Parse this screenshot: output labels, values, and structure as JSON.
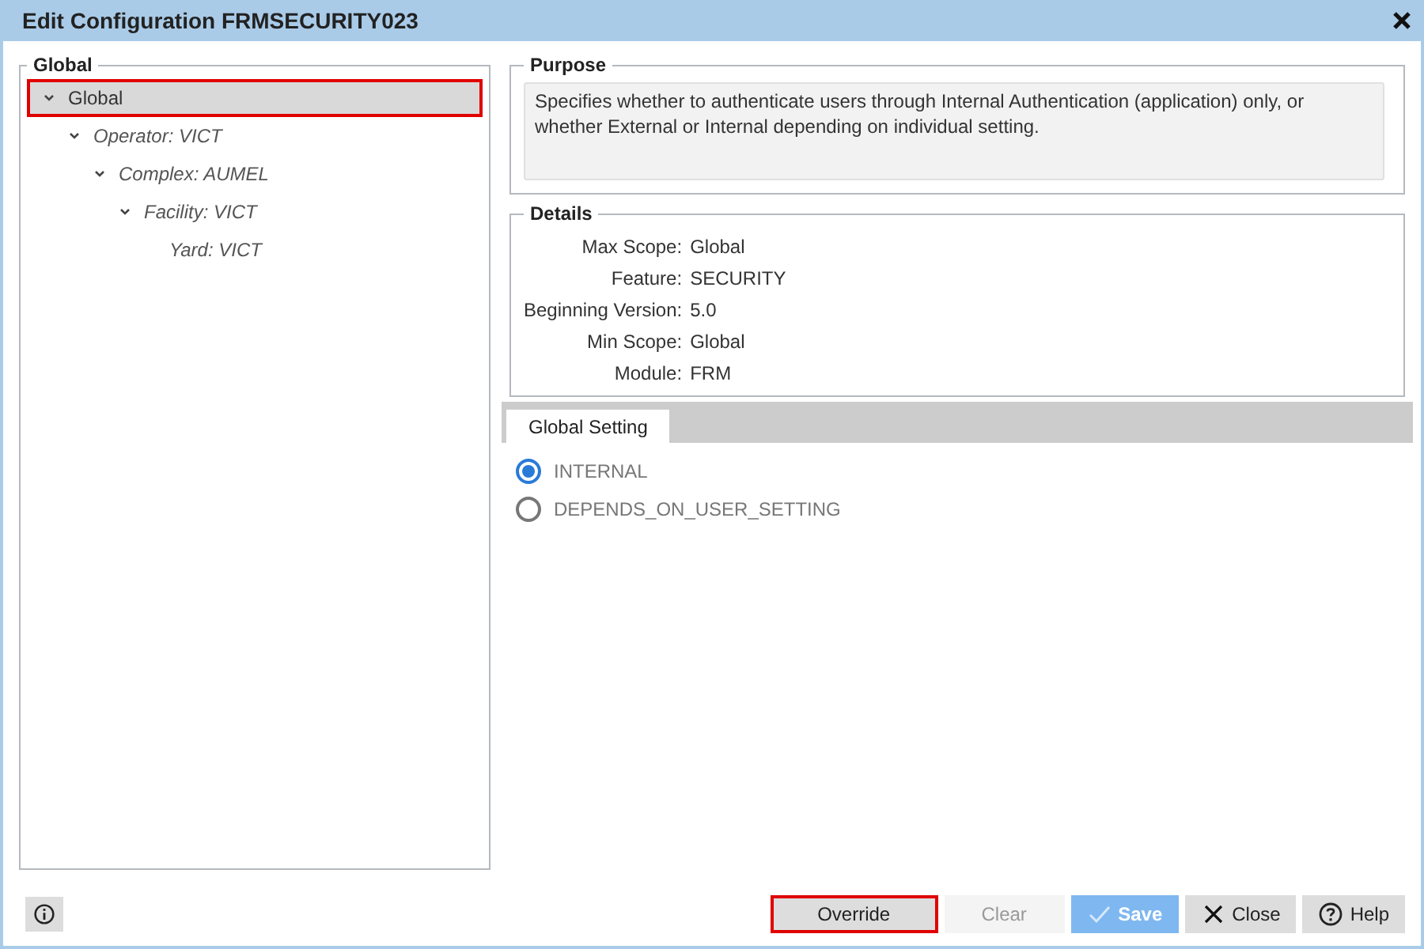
{
  "window": {
    "title": "Edit Configuration FRMSECURITY023"
  },
  "tree": {
    "legend": "Global",
    "items": [
      {
        "label": "Global",
        "expanded": true,
        "selected": true,
        "highlighted": true,
        "children": [
          {
            "label": "Operator: VICT",
            "expanded": true,
            "selected": false,
            "highlighted": false,
            "children": [
              {
                "label": "Complex: AUMEL",
                "expanded": true,
                "selected": false,
                "highlighted": false,
                "children": [
                  {
                    "label": "Facility: VICT",
                    "expanded": true,
                    "selected": false,
                    "highlighted": false,
                    "children": [
                      {
                        "label": "Yard: VICT",
                        "selected": false,
                        "highlighted": false
                      }
                    ]
                  }
                ]
              }
            ]
          }
        ]
      }
    ]
  },
  "purpose": {
    "legend": "Purpose",
    "text": "Specifies whether to authenticate users through Internal Authentication (application) only, or whether External or Internal depending on individual setting."
  },
  "details": {
    "legend": "Details",
    "rows": [
      {
        "label": "Max Scope:",
        "value": "Global"
      },
      {
        "label": "Feature:",
        "value": "SECURITY"
      },
      {
        "label": "Beginning Version:",
        "value": "5.0"
      },
      {
        "label": "Min Scope:",
        "value": "Global"
      },
      {
        "label": "Module:",
        "value": "FRM"
      }
    ]
  },
  "tabs": [
    {
      "label": "Global Setting",
      "selected": true
    }
  ],
  "options": [
    {
      "label": "INTERNAL",
      "selected": true
    },
    {
      "label": "DEPENDS_ON_USER_SETTING",
      "selected": false
    }
  ],
  "buttons": [
    {
      "kind": "plain",
      "label": "Override",
      "disabled": false,
      "highlighted": true
    },
    {
      "kind": "plain",
      "label": "Clear",
      "disabled": true,
      "highlighted": false
    },
    {
      "kind": "save",
      "label": "Save",
      "disabled": true,
      "highlighted": false
    },
    {
      "kind": "close",
      "label": "Close",
      "disabled": false,
      "highlighted": false
    },
    {
      "kind": "help",
      "label": "Help",
      "disabled": false,
      "highlighted": false
    }
  ]
}
